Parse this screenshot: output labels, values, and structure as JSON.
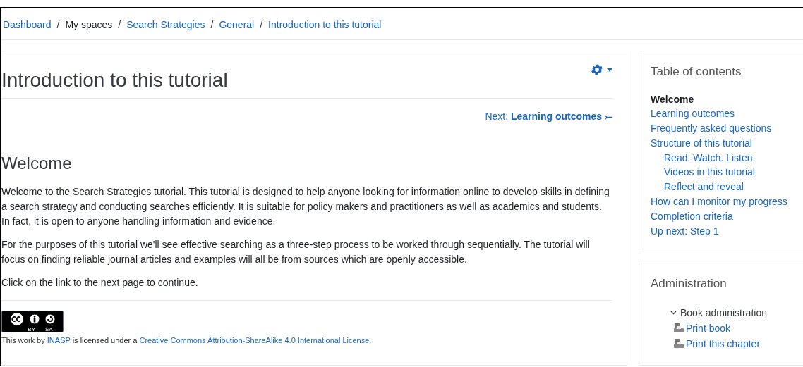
{
  "breadcrumb": [
    {
      "label": "Dashboard",
      "link": true
    },
    {
      "separator": "/",
      "label": "My spaces",
      "link": false
    },
    {
      "separator": "/",
      "label": "Search Strategies",
      "link": true
    },
    {
      "separator": "/",
      "label": "General",
      "link": true
    },
    {
      "separator": "/",
      "label": "Introduction to this tutorial",
      "link": true
    }
  ],
  "page": {
    "title": "Introduction to this tutorial",
    "next_prefix": "Next:",
    "next_label": "Learning outcomes",
    "next_arrow": "⤚",
    "heading": "Welcome",
    "paragraphs": [
      "Welcome to the Search Strategies tutorial. This tutorial is designed to help anyone looking for information online to develop skills in defining a search strategy and conducting searches efficiently. It is suitable for policy makers and practitioners as well as academics and students. In fact, it is open to anyone handling information and evidence.",
      "For the purposes of this tutorial we'll see effective searching as a three-step process to be worked through sequentially. The tutorial will focus on finding reliable journal articles and examples will all be from sources which are openly accessible.",
      "Click on the link to the next page to continue."
    ],
    "license": {
      "badge_by": "BY",
      "badge_sa": "SA",
      "parts": [
        {
          "text": "This work by ",
          "link": false
        },
        {
          "text": "INASP",
          "link": true
        },
        {
          "text": " is licensed under a ",
          "link": false
        },
        {
          "text": "Creative Commons Attribution-ShareAlike 4.0 International License",
          "link": true
        },
        {
          "text": ".",
          "link": false
        }
      ]
    }
  },
  "toc": {
    "title": "Table of contents",
    "items": [
      {
        "label": "Welcome",
        "selected": true
      },
      {
        "label": "Learning outcomes",
        "selected": false
      },
      {
        "label": "Frequently asked questions",
        "selected": false
      },
      {
        "label": "Structure of this tutorial",
        "selected": false,
        "children": [
          {
            "label": "Read. Watch. Listen.",
            "selected": false
          },
          {
            "label": "Videos in this tutorial",
            "selected": false
          },
          {
            "label": "Reflect and reveal",
            "selected": false
          }
        ]
      },
      {
        "label": "How can I monitor my progress",
        "selected": false
      },
      {
        "label": "Completion criteria",
        "selected": false
      },
      {
        "label": "Up next: Step 1",
        "selected": false
      }
    ]
  },
  "administration": {
    "title": "Administration",
    "group": {
      "label": "Book administration",
      "expanded": true,
      "items": [
        "Print book",
        "Print this chapter"
      ]
    }
  }
}
